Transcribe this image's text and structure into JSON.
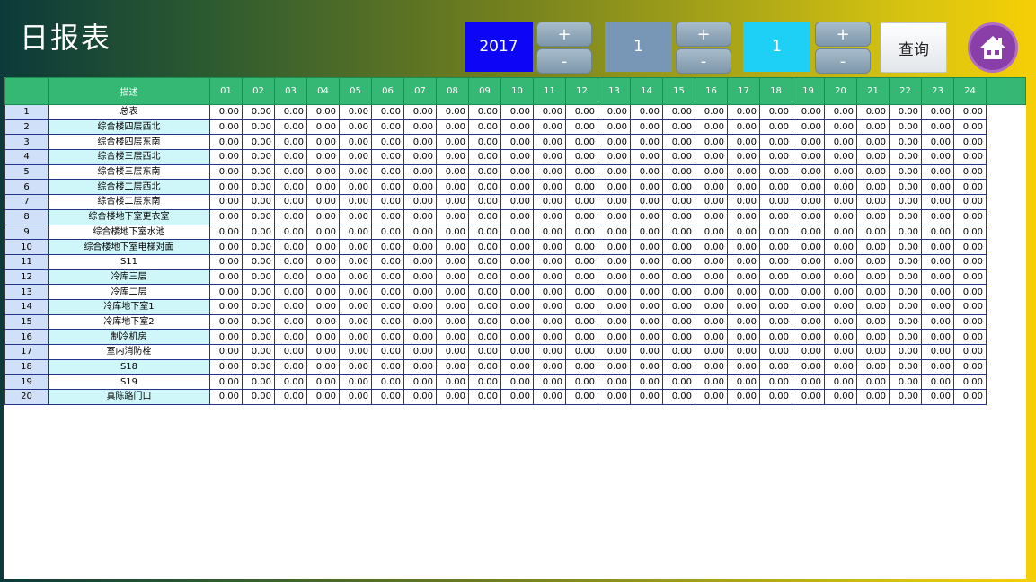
{
  "title": "日报表",
  "controls": {
    "year": "2017",
    "month": "1",
    "day": "1",
    "plus_label": "+",
    "minus_label": "-",
    "query_label": "查询"
  },
  "colors": {
    "year_bg": "#0d06f6",
    "month_bg": "#7897b6",
    "day_bg": "#1fd0f6",
    "header_bg": "#34b874",
    "home_bg": "#8a3ea8"
  },
  "icons": {
    "home": "home-icon"
  },
  "table": {
    "index_header": "",
    "name_header": "描述",
    "hours": [
      "01",
      "02",
      "03",
      "04",
      "05",
      "06",
      "07",
      "08",
      "09",
      "10",
      "11",
      "12",
      "13",
      "14",
      "15",
      "16",
      "17",
      "18",
      "19",
      "20",
      "21",
      "22",
      "23",
      "24"
    ],
    "cell_value": "0.00",
    "rows": [
      {
        "index": "1",
        "name": "总表"
      },
      {
        "index": "2",
        "name": "综合楼四层西北"
      },
      {
        "index": "3",
        "name": "综合楼四层东南"
      },
      {
        "index": "4",
        "name": "综合楼三层西北"
      },
      {
        "index": "5",
        "name": "综合楼三层东南"
      },
      {
        "index": "6",
        "name": "综合楼二层西北"
      },
      {
        "index": "7",
        "name": "综合楼二层东南"
      },
      {
        "index": "8",
        "name": "综合楼地下室更衣室"
      },
      {
        "index": "9",
        "name": "综合楼地下室水池"
      },
      {
        "index": "10",
        "name": "综合楼地下室电梯对面"
      },
      {
        "index": "11",
        "name": "S11"
      },
      {
        "index": "12",
        "name": "冷库三层"
      },
      {
        "index": "13",
        "name": "冷库二层"
      },
      {
        "index": "14",
        "name": "冷库地下室1"
      },
      {
        "index": "15",
        "name": "冷库地下室2"
      },
      {
        "index": "16",
        "name": "制冷机房"
      },
      {
        "index": "17",
        "name": "室内消防栓"
      },
      {
        "index": "18",
        "name": "S18"
      },
      {
        "index": "19",
        "name": "S19"
      },
      {
        "index": "20",
        "name": "真陈路门口"
      }
    ]
  }
}
